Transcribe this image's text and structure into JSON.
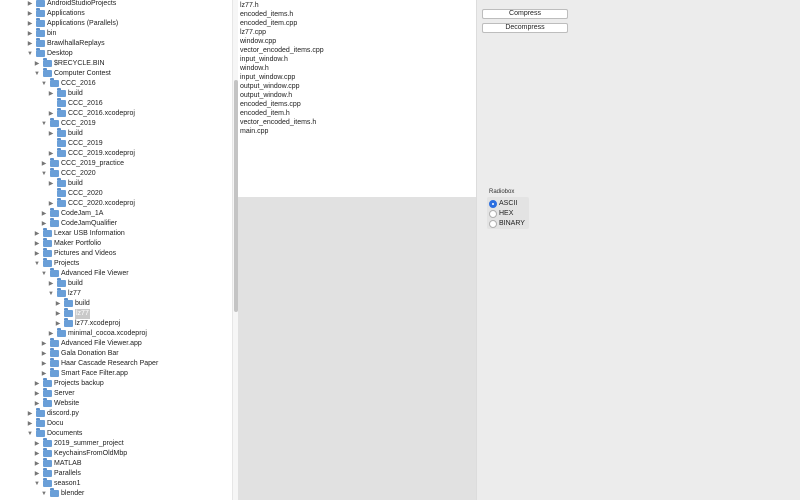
{
  "tree": [
    {
      "label": "AndroidStudioProjects",
      "expanded": false
    },
    {
      "label": "Applications",
      "expanded": false
    },
    {
      "label": "Applications (Parallels)",
      "expanded": false
    },
    {
      "label": "bin",
      "expanded": false
    },
    {
      "label": "BrawlhallaReplays",
      "expanded": false
    },
    {
      "label": "Desktop",
      "expanded": true
    },
    {
      "label": "$RECYCLE.BIN",
      "expanded": false
    },
    {
      "label": "Computer Contest",
      "expanded": true
    },
    {
      "label": "CCC_2016",
      "expanded": true
    },
    {
      "label": "build",
      "expanded": false
    },
    {
      "label": "CCC_2016",
      "expanded": null
    },
    {
      "label": "CCC_2016.xcodeproj",
      "expanded": false
    },
    {
      "label": "CCC_2019",
      "expanded": true
    },
    {
      "label": "build",
      "expanded": false
    },
    {
      "label": "CCC_2019",
      "expanded": null
    },
    {
      "label": "CCC_2019.xcodeproj",
      "expanded": false
    },
    {
      "label": "CCC_2019_practice",
      "expanded": false
    },
    {
      "label": "CCC_2020",
      "expanded": true
    },
    {
      "label": "build",
      "expanded": false
    },
    {
      "label": "CCC_2020",
      "expanded": null
    },
    {
      "label": "CCC_2020.xcodeproj",
      "expanded": false
    },
    {
      "label": "CodeJam_1A",
      "expanded": false
    },
    {
      "label": "CodeJamQualifier",
      "expanded": false
    },
    {
      "label": "Lexar USB Information",
      "expanded": false
    },
    {
      "label": "Maker Portfolio",
      "expanded": false
    },
    {
      "label": "Pictures and Videos",
      "expanded": false
    },
    {
      "label": "Projects",
      "expanded": true
    },
    {
      "label": "Advanced File Viewer",
      "expanded": true
    },
    {
      "label": "build",
      "expanded": false
    },
    {
      "label": "lz77",
      "expanded": true
    },
    {
      "label": "build",
      "expanded": false
    },
    {
      "label": "lz77",
      "expanded": false,
      "selected": true
    },
    {
      "label": "lz77.xcodeproj",
      "expanded": false
    },
    {
      "label": "minimal_cocoa.xcodeproj",
      "expanded": false
    },
    {
      "label": "Advanced File Viewer.app",
      "expanded": false
    },
    {
      "label": "Gala Donation Bar",
      "expanded": false
    },
    {
      "label": "Haar Cascade Research Paper",
      "expanded": false
    },
    {
      "label": "Smart Face Filter.app",
      "expanded": false
    },
    {
      "label": "Projects backup",
      "expanded": false
    },
    {
      "label": "Server",
      "expanded": false
    },
    {
      "label": "Website",
      "expanded": false
    },
    {
      "label": "discord.py",
      "expanded": false
    },
    {
      "label": "Docu",
      "expanded": false
    },
    {
      "label": "Documents",
      "expanded": true
    },
    {
      "label": "2019_summer_project",
      "expanded": false
    },
    {
      "label": "KeychainsFromOldMbp",
      "expanded": false
    },
    {
      "label": "MATLAB",
      "expanded": false
    },
    {
      "label": "Parallels",
      "expanded": false
    },
    {
      "label": "season1",
      "expanded": true
    },
    {
      "label": "blender",
      "expanded": true
    }
  ],
  "files": [
    "lz77.h",
    "encoded_items.h",
    "encoded_item.cpp",
    "lz77.cpp",
    "window.cpp",
    "vector_encoded_items.cpp",
    "input_window.h",
    "window.h",
    "input_window.cpp",
    "output_window.cpp",
    "output_window.h",
    "encoded_items.cpp",
    "encoded_item.h",
    "vector_encoded_items.h",
    "main.cpp"
  ],
  "buttons": {
    "compress": "Compress",
    "decompress": "Decompress"
  },
  "radiobox": {
    "title": "Radiobox",
    "options": [
      "ASCII",
      "HEX",
      "BINARY"
    ],
    "selected": "ASCII"
  },
  "colors": {
    "folder": "#6a9fd8",
    "accent": "#2b6fe0",
    "selection": "#c9c9c9"
  }
}
